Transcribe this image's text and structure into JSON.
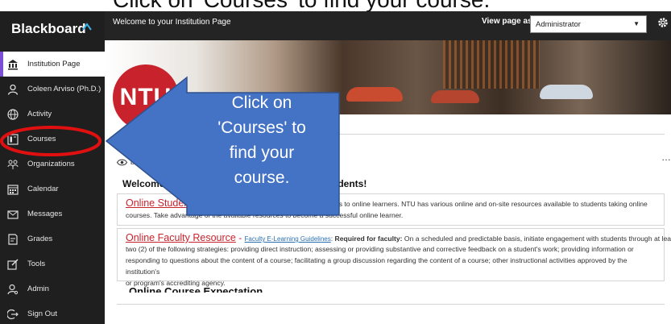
{
  "caption": "Click on 'Courses' to find your course.",
  "brand": "Blackboard",
  "topbar": {
    "title": "Welcome to your Institution Page",
    "view_label": "View page as",
    "view_value": "Administrator"
  },
  "logo_text": "NTU",
  "sidebar": {
    "items": [
      {
        "label": "Institution Page",
        "icon": "institution-icon"
      },
      {
        "label": "Coleen Arviso (Ph.D.)",
        "icon": "user-icon"
      },
      {
        "label": "Activity",
        "icon": "globe-icon"
      },
      {
        "label": "Courses",
        "icon": "courses-icon"
      },
      {
        "label": "Organizations",
        "icon": "organizations-icon"
      },
      {
        "label": "Calendar",
        "icon": "calendar-icon"
      },
      {
        "label": "Messages",
        "icon": "messages-icon"
      },
      {
        "label": "Grades",
        "icon": "grades-icon"
      },
      {
        "label": "Tools",
        "icon": "tools-icon"
      },
      {
        "label": "Admin",
        "icon": "admin-icon"
      },
      {
        "label": "Sign Out",
        "icon": "sign-out-icon"
      }
    ]
  },
  "module": {
    "visibility": "ble to users ▾ |",
    "title_start": "Welcome to the",
    "title_end": "udents!",
    "student": {
      "link": "Online Student",
      "text1": "urces to online learners. NTU has various online and on-site resources available to students taking online",
      "text2": "courses. Take advantage of the available resources to become a successful online learner."
    },
    "faculty": {
      "link": "Online Faculty Resource",
      "separator": " - ",
      "sub_link": "Faculty E-Learning Guidelines",
      "colon": ": ",
      "bold": "Required for faculty:",
      "text1": " On a scheduled and predictable basis, initiate engagement with students through at least",
      "text2": "two (2) of the following strategies: providing direct instruction; assessing or providing substantive and corrective feedback on a student's work; providing information or",
      "text3": "responding to questions about the content of a course; facilitating a group discussion regarding the content of a course; other instructional activities approved by the institution's",
      "text4": "or program's accrediting agency."
    },
    "expectation_title": "Online Course Expectation"
  },
  "callout": {
    "lines": [
      "Click on",
      "'Courses' to",
      "find your",
      "course."
    ],
    "color": "#4472c4",
    "highlight_color": "#e01010"
  }
}
